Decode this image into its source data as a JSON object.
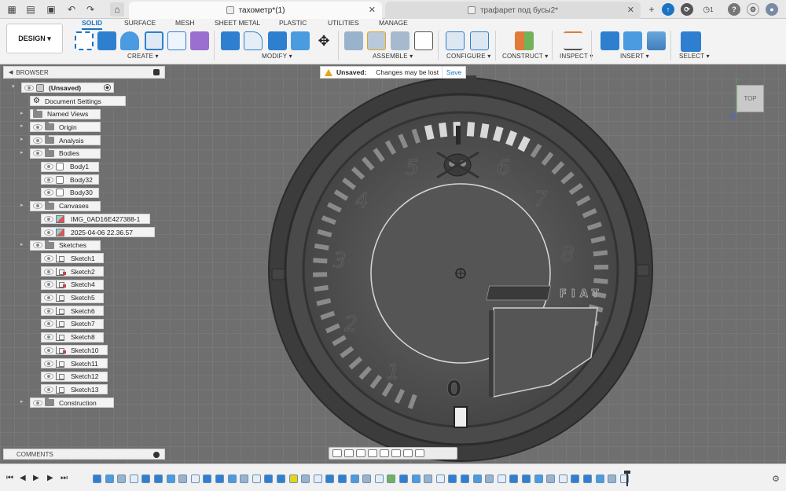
{
  "titlebar": {
    "active_tab": "тахометр*(1)",
    "inactive_tab": "трафарет под бусы2*",
    "notification_count": "1"
  },
  "toolbar": {
    "design_button": "DESIGN ▾",
    "workspace_tabs": [
      "SOLID",
      "SURFACE",
      "MESH",
      "SHEET METAL",
      "PLASTIC",
      "UTILITIES",
      "MANAGE"
    ],
    "groups": [
      "CREATE ▾",
      "MODIFY ▾",
      "ASSEMBLE ▾",
      "CONFIGURE ▾",
      "CONSTRUCT ▾",
      "INSPECT ▾",
      "INSERT ▾",
      "SELECT ▾"
    ]
  },
  "browser": {
    "title": "BROWSER",
    "root": "(Unsaved)",
    "items": [
      {
        "label": "Document Settings",
        "kind": "settings",
        "level": 1,
        "eye": false
      },
      {
        "label": "Named Views",
        "kind": "folder",
        "level": 1,
        "eye": false
      },
      {
        "label": "Origin",
        "kind": "folder",
        "level": 1,
        "eye": true
      },
      {
        "label": "Analysis",
        "kind": "folder",
        "level": 1,
        "eye": true
      },
      {
        "label": "Bodies",
        "kind": "folder",
        "level": 1,
        "eye": true
      },
      {
        "label": "Body1",
        "kind": "body",
        "level": 2,
        "eye": true
      },
      {
        "label": "Body32",
        "kind": "body",
        "level": 2,
        "eye": true
      },
      {
        "label": "Body30",
        "kind": "body",
        "level": 2,
        "eye": true
      },
      {
        "label": "Canvases",
        "kind": "folder",
        "level": 1,
        "eye": true
      },
      {
        "label": "IMG_0AD16E427388-1",
        "kind": "canvas",
        "level": 2,
        "eye": true
      },
      {
        "label": "2025-04-06 22.36.57",
        "kind": "canvas",
        "level": 2,
        "eye": true
      },
      {
        "label": "Sketches",
        "kind": "folder",
        "level": 1,
        "eye": true
      },
      {
        "label": "Sketch1",
        "kind": "sketch",
        "level": 2,
        "eye": true
      },
      {
        "label": "Sketch2",
        "kind": "sketch-warn",
        "level": 2,
        "eye": true
      },
      {
        "label": "Sketch4",
        "kind": "sketch-warn",
        "level": 2,
        "eye": true
      },
      {
        "label": "Sketch5",
        "kind": "sketch",
        "level": 2,
        "eye": true
      },
      {
        "label": "Sketch6",
        "kind": "sketch",
        "level": 2,
        "eye": true
      },
      {
        "label": "Sketch7",
        "kind": "sketch",
        "level": 2,
        "eye": true
      },
      {
        "label": "Sketch8",
        "kind": "sketch",
        "level": 2,
        "eye": true
      },
      {
        "label": "Sketch10",
        "kind": "sketch-warn",
        "level": 2,
        "eye": true
      },
      {
        "label": "Sketch11",
        "kind": "sketch",
        "level": 2,
        "eye": true
      },
      {
        "label": "Sketch12",
        "kind": "sketch",
        "level": 2,
        "eye": true
      },
      {
        "label": "Sketch13",
        "kind": "sketch",
        "level": 2,
        "eye": true
      },
      {
        "label": "Construction",
        "kind": "folder",
        "level": 1,
        "eye": true
      }
    ]
  },
  "notification": {
    "label": "Unsaved:",
    "message": "Changes may be lost",
    "action": "Save"
  },
  "viewcube": {
    "face": "TOP",
    "axis_y": "Y",
    "axis_z": "Z"
  },
  "dial": {
    "numbers": [
      "0",
      "1",
      "2",
      "3",
      "4",
      "5",
      "6",
      "7",
      "8"
    ],
    "brand": "FIAT"
  },
  "comments": {
    "title": "COMMENTS"
  },
  "colors": {
    "accent": "#1a73c5",
    "warning": "#e8a317",
    "body": "#4a4a4a",
    "ring": "#3b3b3b"
  }
}
